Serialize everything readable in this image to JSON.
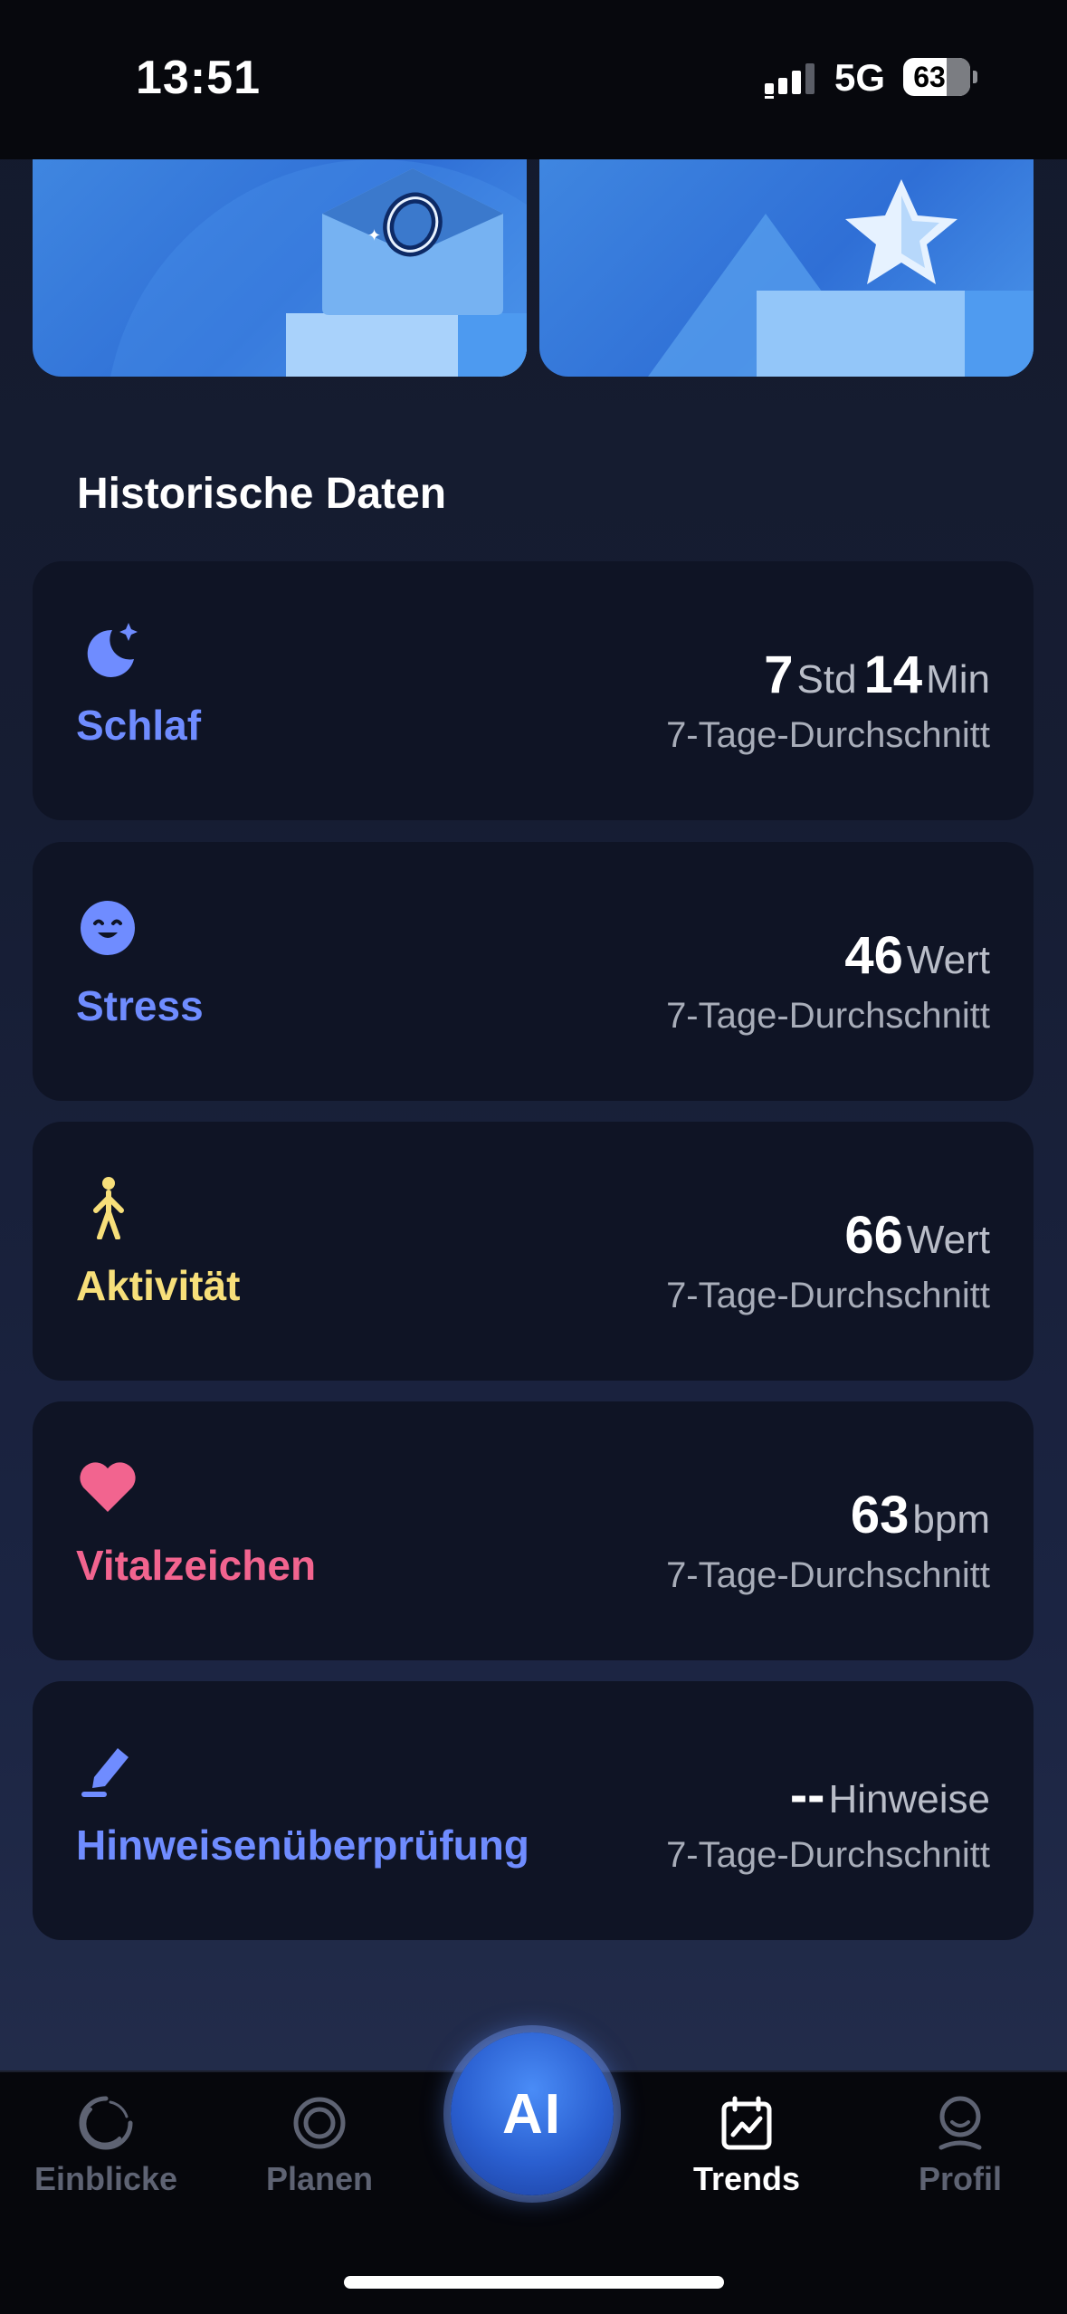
{
  "status_bar": {
    "time": "13:51",
    "network": "5G",
    "battery": "63"
  },
  "section_title": "Historische Daten",
  "cards": [
    {
      "label": "Schlaf",
      "icon": "moon-star-icon",
      "color": "#6f8cff",
      "value_parts": [
        {
          "num": "7",
          "unit": "Std"
        },
        {
          "num": "14",
          "unit": "Min"
        }
      ],
      "subtitle": "7-Tage-Durchschnitt"
    },
    {
      "label": "Stress",
      "icon": "smiley-icon",
      "color": "#6f8cff",
      "value_parts": [
        {
          "num": "46",
          "unit": "Wert"
        }
      ],
      "subtitle": "7-Tage-Durchschnitt"
    },
    {
      "label": "Aktivität",
      "icon": "walking-icon",
      "color": "#f7df7a",
      "value_parts": [
        {
          "num": "66",
          "unit": "Wert"
        }
      ],
      "subtitle": "7-Tage-Durchschnitt"
    },
    {
      "label": "Vitalzeichen",
      "icon": "heart-icon",
      "color": "#f2648f",
      "value_parts": [
        {
          "num": "63",
          "unit": "bpm"
        }
      ],
      "subtitle": "7-Tage-Durchschnitt"
    },
    {
      "label": "Hinweisenüberprüfung",
      "icon": "edit-pen-icon",
      "color": "#6f8cff",
      "value_parts": [
        {
          "num": "--",
          "unit": "Hinweise"
        }
      ],
      "subtitle": "7-Tage-Durchschnitt"
    }
  ],
  "nav": {
    "items": [
      {
        "label": "Einblicke",
        "icon": "insights-icon",
        "active": false
      },
      {
        "label": "Planen",
        "icon": "plan-ring-icon",
        "active": false
      },
      {
        "label": "Trends",
        "icon": "trends-calendar-icon",
        "active": true
      },
      {
        "label": "Profil",
        "icon": "profile-icon",
        "active": false
      }
    ],
    "ai_label": "AI"
  }
}
